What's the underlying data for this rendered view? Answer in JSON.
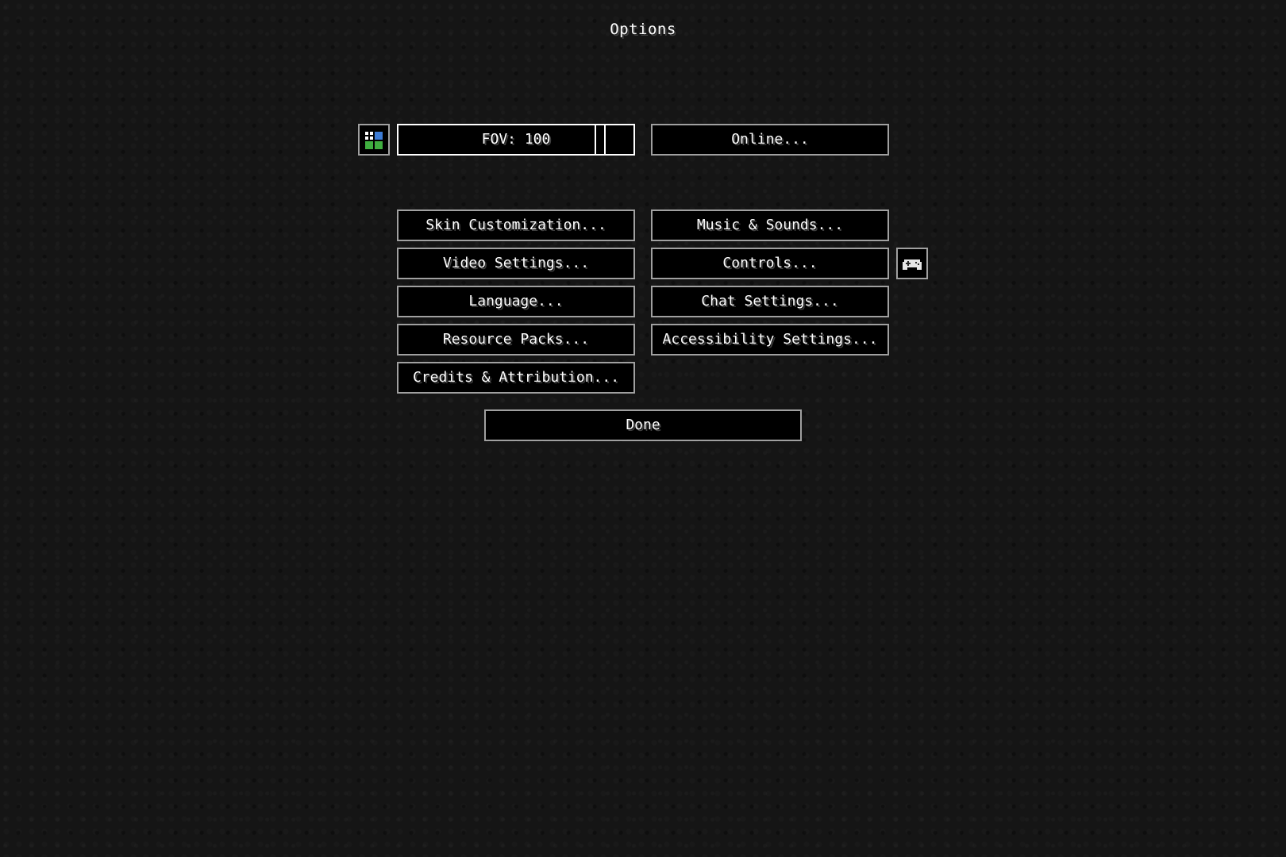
{
  "screen": {
    "title": "Options"
  },
  "top_row": {
    "difficulty_icon": "grid-squares-icon",
    "fov_slider": {
      "label": "FOV: 100",
      "value": 100,
      "min": 30,
      "max": 110
    },
    "online_label": "Online..."
  },
  "buttons": {
    "skin": "Skin Customization...",
    "music": "Music & Sounds...",
    "video": "Video Settings...",
    "controls": "Controls...",
    "language": "Language...",
    "chat": "Chat Settings...",
    "resource_packs": "Resource Packs...",
    "accessibility": "Accessibility Settings...",
    "credits": "Credits & Attribution...",
    "done": "Done"
  },
  "controller_icon": "gamepad-icon",
  "colors": {
    "button_border": "#a0a0a0",
    "button_border_active": "#ffffff",
    "button_fill": "#000000",
    "text": "#ffffff",
    "icon_blue": "#3d7cd6",
    "icon_green": "#3fae3f"
  }
}
